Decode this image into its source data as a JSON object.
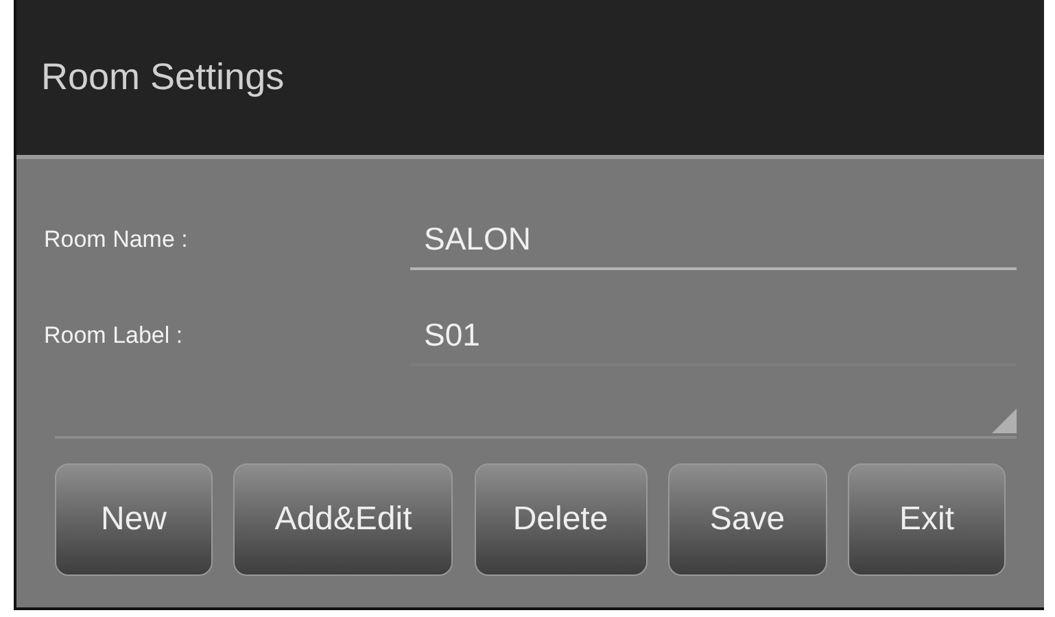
{
  "window": {
    "title": "Room Settings"
  },
  "fields": [
    {
      "label": "Room Name :",
      "value": "SALON",
      "focused": true
    },
    {
      "label": "Room Label :",
      "value": "S01",
      "focused": false
    }
  ],
  "buttons": [
    "New",
    "Add&Edit",
    "Delete",
    "Save",
    "Exit"
  ]
}
